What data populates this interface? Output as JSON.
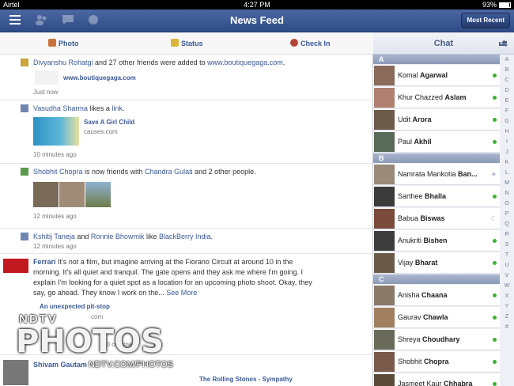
{
  "status_bar": {
    "carrier": "Airtel",
    "time": "4:27 PM",
    "battery": "93%"
  },
  "navbar": {
    "title": "News Feed",
    "button": "Most Recent"
  },
  "publisher": {
    "photo": "Photo",
    "status": "Status",
    "checkin": "Check In"
  },
  "stories": [
    {
      "actor": "Divyanshu Rohatgi",
      "mid": " and 27 other friends were added to ",
      "target": "www.boutiquegaga.com",
      "end": ".",
      "link_title": "www.boutiquegaga.com",
      "time": "Just now"
    },
    {
      "actor": "Vasudha Sharma",
      "mid": " likes a ",
      "target": "link",
      "end": ".",
      "link_title": "Save A Girl Child",
      "link_domain": "causes.com",
      "time": "10 minutes ago"
    },
    {
      "actor": "Shobhit Chopra",
      "mid": " is now friends with ",
      "target": "Chandra Gulati",
      "end": " and 2 other people.",
      "time": "12 minutes ago"
    },
    {
      "actor": "Kshitij Taneja",
      "mid": " and ",
      "target": "Ronnie Bhowmik",
      "mid2": " like ",
      "target2": "BlackBerry India",
      "end": ".",
      "time": "12 minutes ago"
    },
    {
      "actor": "Ferrari",
      "body": " It's not a film, but imagine arriving at the Fiorano Circuit at around 10 in the morning. It's all quiet and tranquil. The gate opens and they ask me where I'm going. I explain I'm looking for a quiet spot as a location for an upcoming photo shoot. Okay, they say, go ahead. They know I work on the...",
      "more": "See More",
      "link_title": "An unexpected pit-stop",
      "link_domain": "com",
      "time": "20 comme"
    },
    {
      "actor": "Shivam Gautam",
      "link_title": "The Rolling Stones - Sympathy"
    }
  ],
  "chat": {
    "title": "Chat",
    "sections": [
      {
        "letter": "A",
        "contacts": [
          {
            "first": "Komal ",
            "last": "Agarwal",
            "status": "online"
          },
          {
            "first": "Khur Chazzed ",
            "last": "Aslam",
            "status": "online"
          },
          {
            "first": "Udit ",
            "last": "Arora",
            "status": "online"
          },
          {
            "first": "Paul ",
            "last": "Akhil",
            "status": "online"
          }
        ]
      },
      {
        "letter": "B",
        "contacts": [
          {
            "first": "Namrata Mankotia ",
            "last": "Ban...",
            "status": "mobile"
          },
          {
            "first": "Sarthee ",
            "last": "Bhalla",
            "status": "online"
          },
          {
            "first": "Babua ",
            "last": "Biswas",
            "status": "idle"
          },
          {
            "first": "Anukriti ",
            "last": "Bishen",
            "status": "online"
          },
          {
            "first": "Vijay ",
            "last": "Bharat",
            "status": "online"
          }
        ]
      },
      {
        "letter": "C",
        "contacts": [
          {
            "first": "Anisha ",
            "last": "Chaana",
            "status": "online"
          },
          {
            "first": "Gaurav ",
            "last": "Chawla",
            "status": "online"
          },
          {
            "first": "Shreya ",
            "last": "Choudhary",
            "status": "online"
          },
          {
            "first": "Shobhit ",
            "last": "Chopra",
            "status": "online"
          },
          {
            "first": "Jasmeet Kaur ",
            "last": "Chhabra",
            "status": "online"
          }
        ]
      }
    ],
    "index": [
      "A",
      "B",
      "C",
      "D",
      "E",
      "F",
      "G",
      "H",
      "I",
      "J",
      "K",
      "L",
      "M",
      "N",
      "O",
      "P",
      "Q",
      "R",
      "S",
      "T",
      "U",
      "V",
      "W",
      "X",
      "Y",
      "Z",
      "#"
    ]
  },
  "watermark": {
    "brand": "NDTV",
    "photos": "PHOTOS",
    "url": "NDTV.COM/PHOTOS"
  }
}
